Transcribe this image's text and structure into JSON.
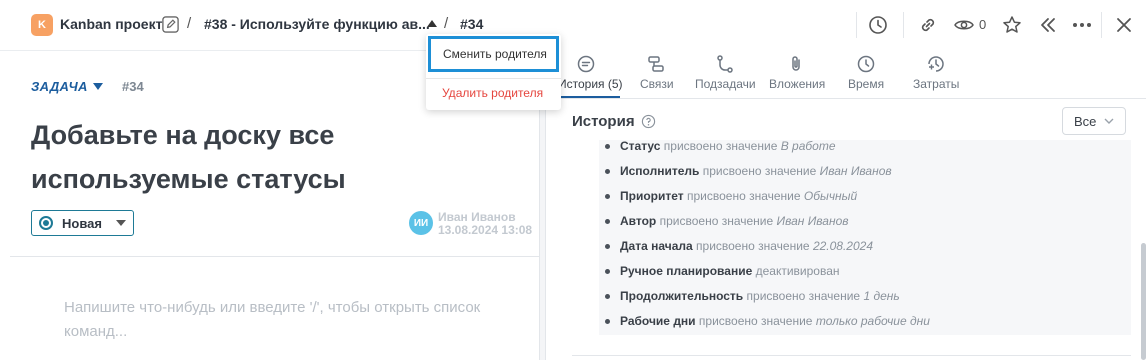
{
  "header": {
    "project_badge": "K",
    "project_name": "Kanban проект",
    "separator": "/",
    "parent_task": "#38 - Используйте функцию ав...",
    "current_task": "#34",
    "views_count": "0"
  },
  "parent_menu": {
    "change_parent": "Сменить родителя",
    "remove_parent": "Удалить родителя"
  },
  "task": {
    "type": "ЗАДАЧА",
    "number": "#34",
    "title": "Добавьте на доску все используемые статусы",
    "status": "Новая",
    "author_initials": "ИИ",
    "author_name": "Иван Иванов",
    "created_at": "13.08.2024 13:08",
    "comment_placeholder": "Напишите что-нибудь или введите '/', чтобы открыть список команд..."
  },
  "tabs": [
    {
      "label": "История (5)",
      "icon": "chat-icon"
    },
    {
      "label": "Связи",
      "icon": "links-icon"
    },
    {
      "label": "Подзадачи",
      "icon": "subtasks-icon"
    },
    {
      "label": "Вложения",
      "icon": "paperclip-icon"
    },
    {
      "label": "Время",
      "icon": "clock-icon"
    },
    {
      "label": "Затраты",
      "icon": "costs-icon"
    }
  ],
  "history": {
    "title": "История",
    "filter_value": "Все",
    "entries": [
      {
        "field": "Статус",
        "action": "присвоено значение",
        "value": "В работе"
      },
      {
        "field": "Исполнитель",
        "action": "присвоено значение",
        "value": "Иван Иванов"
      },
      {
        "field": "Приоритет",
        "action": "присвоено значение",
        "value": "Обычный"
      },
      {
        "field": "Автор",
        "action": "присвоено значение",
        "value": "Иван Иванов"
      },
      {
        "field": "Дата начала",
        "action": "присвоено значение",
        "value": "22.08.2024"
      },
      {
        "field": "Ручное планирование",
        "action": "деактивирован",
        "value": ""
      },
      {
        "field": "Продолжительность",
        "action": "присвоено значение",
        "value": "1 день"
      },
      {
        "field": "Рабочие дни",
        "action": "присвоено значение",
        "value": "только рабочие дни"
      }
    ]
  },
  "colors": {
    "accent": "#1c5d9e",
    "status": "#1e7a96",
    "danger": "#e5463f",
    "project_badge": "#f7a163",
    "avatar": "#5bc2e7",
    "highlight": "#1d8fd6"
  }
}
